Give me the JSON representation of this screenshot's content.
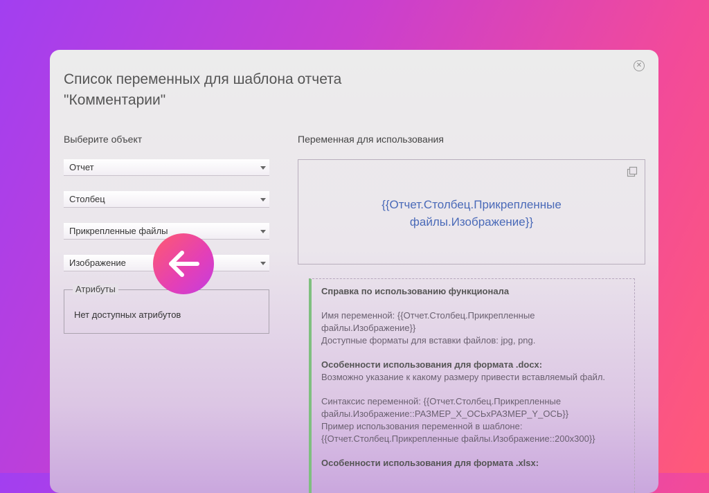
{
  "dialog": {
    "title_line1": "Список переменных для шаблона отчета",
    "title_line2": "\"Комментарии\"",
    "close_icon": "close-circle-icon"
  },
  "left": {
    "label": "Выберите объект",
    "selects": [
      "Отчет",
      "Столбец",
      "Прикрепленные файлы",
      "Изображение"
    ],
    "attributes": {
      "legend": "Атрибуты",
      "empty_text": "Нет доступных атрибутов"
    }
  },
  "right": {
    "label": "Переменная для использования",
    "variable_line1": "{{Отчет.Столбец.Прикрепленные",
    "variable_line2": "файлы.Изображение}}",
    "copy_icon": "copy-icon"
  },
  "help": {
    "title": "Справка по использованию функционала",
    "name_line1": "Имя переменной: {{Отчет.Столбец.Прикрепленные",
    "name_line2": "файлы.Изображение}}",
    "formats": "Доступные форматы для вставки файлов: jpg, png.",
    "docx_title": "Особенности использования для формата .docx:",
    "docx_text": "Возможно указание к какому размеру привести вставляемый файл.",
    "syntax_line1": "Синтаксис переменной: {{Отчет.Столбец.Прикрепленные",
    "syntax_line2": "файлы.Изображение::РАЗМЕР_X_ОСЬxРАЗМЕР_Y_ОСЬ}}",
    "example_line1": "Пример использования переменной в шаблоне:",
    "example_line2": "{{Отчет.Столбец.Прикрепленные файлы.Изображение::200x300}}",
    "xlsx_title": "Особенности использования для формата .xlsx:"
  },
  "overlay": {
    "back_icon": "arrow-left-icon",
    "accent_start": "#ff5a6e",
    "accent_end": "#c33ee0"
  }
}
